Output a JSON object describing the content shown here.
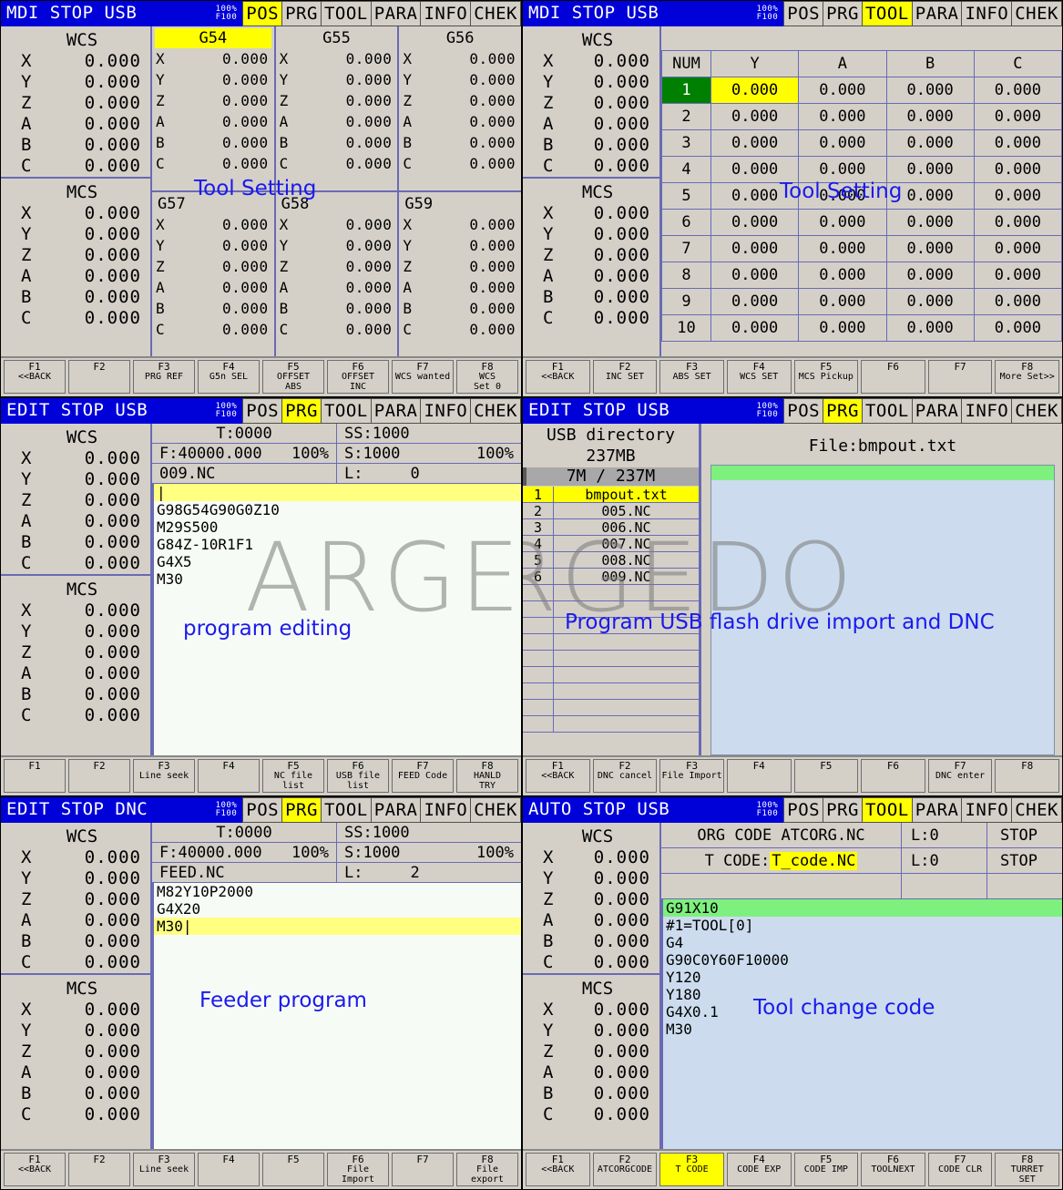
{
  "watermark": "ARGEDO",
  "tabs": [
    "POS",
    "PRG",
    "TOOL",
    "PARA",
    "INFO",
    "CHEK"
  ],
  "feed_override": {
    "line1": "100%",
    "line2": "F100"
  },
  "axes": [
    "X",
    "Y",
    "Z",
    "A",
    "B",
    "C"
  ],
  "zero": "0.000",
  "labels": {
    "wcs": "WCS",
    "mcs": "MCS"
  },
  "panels": {
    "pos": {
      "mode": "MDI  STOP USB",
      "active_tab": "POS",
      "annotation": "Tool Setting",
      "wcs_values": [
        "0.000",
        "0.000",
        "0.000",
        "0.000",
        "0.000",
        "0.000"
      ],
      "mcs_values": [
        "0.000",
        "0.000",
        "0.000",
        "0.000",
        "0.000",
        "0.000"
      ],
      "offset_groups": [
        {
          "name": "G54",
          "selected": true,
          "values": [
            "0.000",
            "0.000",
            "0.000",
            "0.000",
            "0.000",
            "0.000"
          ]
        },
        {
          "name": "G55",
          "selected": false,
          "values": [
            "0.000",
            "0.000",
            "0.000",
            "0.000",
            "0.000",
            "0.000"
          ]
        },
        {
          "name": "G56",
          "selected": false,
          "values": [
            "0.000",
            "0.000",
            "0.000",
            "0.000",
            "0.000",
            "0.000"
          ]
        },
        {
          "name": "G57",
          "selected": false,
          "values": [
            "0.000",
            "0.000",
            "0.000",
            "0.000",
            "0.000",
            "0.000"
          ]
        },
        {
          "name": "G58",
          "selected": false,
          "values": [
            "0.000",
            "0.000",
            "0.000",
            "0.000",
            "0.000",
            "0.000"
          ]
        },
        {
          "name": "G59",
          "selected": false,
          "values": [
            "0.000",
            "0.000",
            "0.000",
            "0.000",
            "0.000",
            "0.000"
          ]
        }
      ],
      "fkeys": [
        {
          "id": "F1",
          "label": "<<BACK"
        },
        {
          "id": "F2",
          "label": ""
        },
        {
          "id": "F3",
          "label": "PRG REF"
        },
        {
          "id": "F4",
          "label": "G5n SEL"
        },
        {
          "id": "F5",
          "label": "OFFSET\nABS"
        },
        {
          "id": "F6",
          "label": "OFFSET\nINC"
        },
        {
          "id": "F7",
          "label": "WCS wanted"
        },
        {
          "id": "F8",
          "label": "WCS\nSet 0"
        }
      ]
    },
    "tool": {
      "mode": "MDI  STOP USB",
      "active_tab": "TOOL",
      "annotation": "Tool Setting",
      "wcs_values": [
        "0.000",
        "0.000",
        "0.000",
        "0.000",
        "0.000",
        "0.000"
      ],
      "mcs_values": [
        "0.000",
        "0.000",
        "0.000",
        "0.000",
        "0.000",
        "0.000"
      ],
      "table": {
        "columns": [
          "NUM",
          "Y",
          "A",
          "B",
          "C"
        ],
        "selected_row": 1,
        "selected_col": 1,
        "rows": [
          {
            "num": "1",
            "cells": [
              "0.000",
              "0.000",
              "0.000",
              "0.000"
            ]
          },
          {
            "num": "2",
            "cells": [
              "0.000",
              "0.000",
              "0.000",
              "0.000"
            ]
          },
          {
            "num": "3",
            "cells": [
              "0.000",
              "0.000",
              "0.000",
              "0.000"
            ]
          },
          {
            "num": "4",
            "cells": [
              "0.000",
              "0.000",
              "0.000",
              "0.000"
            ]
          },
          {
            "num": "5",
            "cells": [
              "0.000",
              "0.000",
              "0.000",
              "0.000"
            ]
          },
          {
            "num": "6",
            "cells": [
              "0.000",
              "0.000",
              "0.000",
              "0.000"
            ]
          },
          {
            "num": "7",
            "cells": [
              "0.000",
              "0.000",
              "0.000",
              "0.000"
            ]
          },
          {
            "num": "8",
            "cells": [
              "0.000",
              "0.000",
              "0.000",
              "0.000"
            ]
          },
          {
            "num": "9",
            "cells": [
              "0.000",
              "0.000",
              "0.000",
              "0.000"
            ]
          },
          {
            "num": "10",
            "cells": [
              "0.000",
              "0.000",
              "0.000",
              "0.000"
            ]
          }
        ]
      },
      "fkeys": [
        {
          "id": "F1",
          "label": "<<BACK"
        },
        {
          "id": "F2",
          "label": "INC SET"
        },
        {
          "id": "F3",
          "label": "ABS SET"
        },
        {
          "id": "F4",
          "label": "WCS SET"
        },
        {
          "id": "F5",
          "label": "MCS Pickup"
        },
        {
          "id": "F6",
          "label": ""
        },
        {
          "id": "F7",
          "label": ""
        },
        {
          "id": "F8",
          "label": "More Set>>"
        }
      ]
    },
    "prg_edit": {
      "mode": "EDIT STOP USB",
      "active_tab": "PRG",
      "annotation": "program editing",
      "wcs_values": [
        "0.000",
        "0.000",
        "0.000",
        "0.000",
        "0.000",
        "0.000"
      ],
      "mcs_values": [
        "0.000",
        "0.000",
        "0.000",
        "0.000",
        "0.000",
        "0.000"
      ],
      "info": {
        "t": "T:0000",
        "ss": "SS:1000",
        "f": "F:40000.000",
        "f_pct": "100%",
        "s": "S:1000",
        "s_pct": "100%",
        "file": "009.NC",
        "l_label": "L:",
        "l_value": "0"
      },
      "program_lines": [
        {
          "text": "",
          "highlight": "yellow",
          "caret": true
        },
        {
          "text": "G98G54G90G0Z10",
          "highlight": "none"
        },
        {
          "text": "M29S500",
          "highlight": "none"
        },
        {
          "text": "G84Z-10R1F1",
          "highlight": "none"
        },
        {
          "text": "G4X5",
          "highlight": "none"
        },
        {
          "text": "M30",
          "highlight": "none"
        }
      ],
      "fkeys": [
        {
          "id": "F1",
          "label": ""
        },
        {
          "id": "F2",
          "label": ""
        },
        {
          "id": "F3",
          "label": "Line seek"
        },
        {
          "id": "F4",
          "label": ""
        },
        {
          "id": "F5",
          "label": "NC file\nlist"
        },
        {
          "id": "F6",
          "label": "USB file\nlist"
        },
        {
          "id": "F7",
          "label": "FEED Code"
        },
        {
          "id": "F8",
          "label": "HANLD\nTRY"
        }
      ]
    },
    "usb": {
      "mode": "EDIT STOP USB",
      "active_tab": "PRG",
      "annotation": "Program USB flash drive import and DNC",
      "directory_title": "USB directory",
      "directory_size": "237MB",
      "usage": "7M / 237M",
      "usage_percent": 3,
      "file_label": "File:bmpout.txt",
      "files": [
        {
          "n": "1",
          "name": "bmpout.txt",
          "selected": true
        },
        {
          "n": "2",
          "name": "005.NC",
          "selected": false
        },
        {
          "n": "3",
          "name": "006.NC",
          "selected": false
        },
        {
          "n": "4",
          "name": "007.NC",
          "selected": false
        },
        {
          "n": "5",
          "name": "008.NC",
          "selected": false
        },
        {
          "n": "6",
          "name": "009.NC",
          "selected": false
        },
        {
          "n": "",
          "name": "",
          "selected": false
        },
        {
          "n": "",
          "name": "",
          "selected": false
        },
        {
          "n": "",
          "name": "",
          "selected": false
        },
        {
          "n": "",
          "name": "",
          "selected": false
        },
        {
          "n": "",
          "name": "",
          "selected": false
        },
        {
          "n": "",
          "name": "",
          "selected": false
        },
        {
          "n": "",
          "name": "",
          "selected": false
        },
        {
          "n": "",
          "name": "",
          "selected": false
        },
        {
          "n": "",
          "name": "",
          "selected": false
        }
      ],
      "fkeys": [
        {
          "id": "F1",
          "label": "<<BACK"
        },
        {
          "id": "F2",
          "label": "DNC cancel"
        },
        {
          "id": "F3",
          "label": "File Import"
        },
        {
          "id": "F4",
          "label": ""
        },
        {
          "id": "F5",
          "label": ""
        },
        {
          "id": "F6",
          "label": ""
        },
        {
          "id": "F7",
          "label": "DNC enter"
        },
        {
          "id": "F8",
          "label": ""
        }
      ]
    },
    "feeder": {
      "mode": "EDIT STOP DNC",
      "active_tab": "PRG",
      "annotation": "Feeder program",
      "wcs_values": [
        "0.000",
        "0.000",
        "0.000",
        "0.000",
        "0.000",
        "0.000"
      ],
      "mcs_values": [
        "0.000",
        "0.000",
        "0.000",
        "0.000",
        "0.000",
        "0.000"
      ],
      "info": {
        "t": "T:0000",
        "ss": "SS:1000",
        "f": "F:40000.000",
        "f_pct": "100%",
        "s": "S:1000",
        "s_pct": "100%",
        "file": "FEED.NC",
        "l_label": "L:",
        "l_value": "2"
      },
      "program_lines": [
        {
          "text": "M82Y10P2000",
          "highlight": "none"
        },
        {
          "text": "G4X20",
          "highlight": "none"
        },
        {
          "text": "M30",
          "highlight": "yellow",
          "caret": true
        }
      ],
      "fkeys": [
        {
          "id": "F1",
          "label": "<<BACK"
        },
        {
          "id": "F2",
          "label": ""
        },
        {
          "id": "F3",
          "label": "Line seek"
        },
        {
          "id": "F4",
          "label": ""
        },
        {
          "id": "F5",
          "label": ""
        },
        {
          "id": "F6",
          "label": "File Import"
        },
        {
          "id": "F7",
          "label": ""
        },
        {
          "id": "F8",
          "label": "File export"
        }
      ]
    },
    "toolchange": {
      "mode": "AUTO STOP USB",
      "active_tab": "TOOL",
      "annotation": "Tool change code",
      "wcs_values": [
        "0.000",
        "0.000",
        "0.000",
        "0.000",
        "0.000",
        "0.000"
      ],
      "mcs_values": [
        "0.000",
        "0.000",
        "0.000",
        "0.000",
        "0.000",
        "0.000"
      ],
      "rows": [
        {
          "main": "ORG  CODE ATCORG.NC",
          "highlight": false,
          "l": "L:0",
          "status": "STOP"
        },
        {
          "main_prefix": "T  CODE:",
          "main_value": "T_code.NC",
          "highlight": true,
          "l": "L:0",
          "status": "STOP"
        },
        {
          "main": "",
          "highlight": false,
          "l": "",
          "status": ""
        }
      ],
      "program_lines": [
        {
          "text": "G91X10",
          "highlight": "green"
        },
        {
          "text": "#1=TOOL[0]",
          "highlight": "none"
        },
        {
          "text": "G4",
          "highlight": "none"
        },
        {
          "text": "G90C0Y60F10000",
          "highlight": "none"
        },
        {
          "text": "Y120",
          "highlight": "none"
        },
        {
          "text": "Y180",
          "highlight": "none"
        },
        {
          "text": "G4X0.1",
          "highlight": "none"
        },
        {
          "text": "M30",
          "highlight": "none"
        }
      ],
      "fkeys": [
        {
          "id": "F1",
          "label": "<<BACK",
          "active": false
        },
        {
          "id": "F2",
          "label": "ATCORGCODE",
          "active": false
        },
        {
          "id": "F3",
          "label": "T CODE",
          "active": true
        },
        {
          "id": "F4",
          "label": "CODE EXP",
          "active": false
        },
        {
          "id": "F5",
          "label": "CODE IMP",
          "active": false
        },
        {
          "id": "F6",
          "label": "TOOLNEXT",
          "active": false
        },
        {
          "id": "F7",
          "label": "CODE CLR",
          "active": false
        },
        {
          "id": "F8",
          "label": "TURRET\nSET",
          "active": false
        }
      ]
    }
  },
  "colors": {
    "titlebar": "#0000d8",
    "panel_bg": "#d4d0c8",
    "highlight_yellow": "#ffff00",
    "highlight_green": "#7ef07e",
    "selected_green": "#008000",
    "grid_line": "#6a6ab4",
    "annotation_blue": "#1a1aee",
    "editor_bg": "#f7fbf6",
    "viewer_bg": "#ccdcee"
  }
}
